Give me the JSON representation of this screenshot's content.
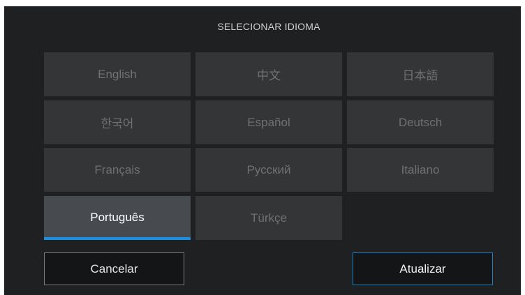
{
  "dialog": {
    "title": "SELECIONAR IDIOMA",
    "languages": [
      "English",
      "中文",
      "日本語",
      "한국어",
      "Español",
      "Deutsch",
      "Français",
      "Русский",
      "Italiano",
      "Português",
      "Türkçe"
    ],
    "selected": "Português",
    "cancel_label": "Cancelar",
    "update_label": "Atualizar"
  },
  "colors": {
    "panel_bg": "#1f2021",
    "button_bg": "#333536",
    "selected_bg": "#474a4f",
    "accent": "#1a8fe3"
  }
}
